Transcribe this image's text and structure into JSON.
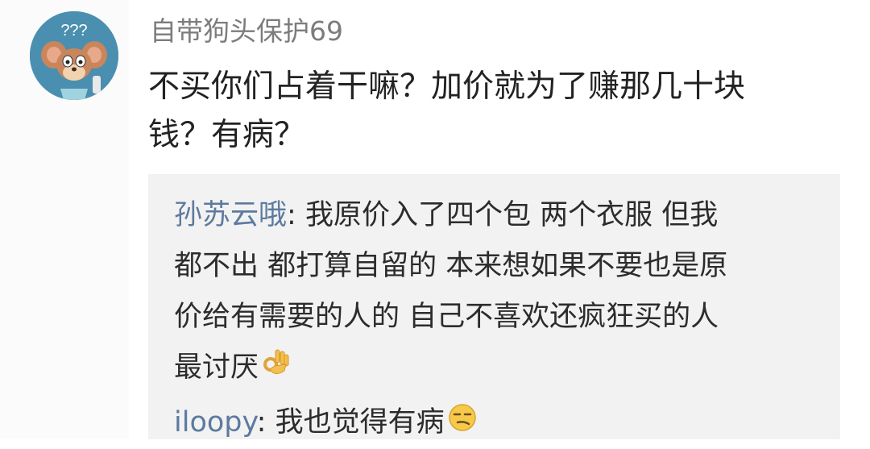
{
  "comment": {
    "username": "自带狗头保护69",
    "text_lines": [
      "不买你们占着干嘛？加价就为了赚那几十块",
      "钱？有病？"
    ],
    "avatar_text": "???"
  },
  "replies": [
    {
      "user": "孙苏云哦",
      "separator": ": ",
      "lines": [
        "我原价入了四个包 两个衣服 但我",
        "都不出 都打算自留的 本来想如果不要也是原",
        "价给有需要的人的 自己不喜欢还疯狂买的人",
        "最讨厌"
      ],
      "emoji": "ok-hand-icon"
    },
    {
      "user": "iloopy",
      "separator": ": ",
      "lines": [
        "我也觉得有病"
      ],
      "emoji": "smirk-face-icon"
    }
  ],
  "colors": {
    "username": "#7c7c7c",
    "reply_user": "#5d7a9f",
    "reply_bg": "#f2f2f2",
    "text": "#222222"
  }
}
